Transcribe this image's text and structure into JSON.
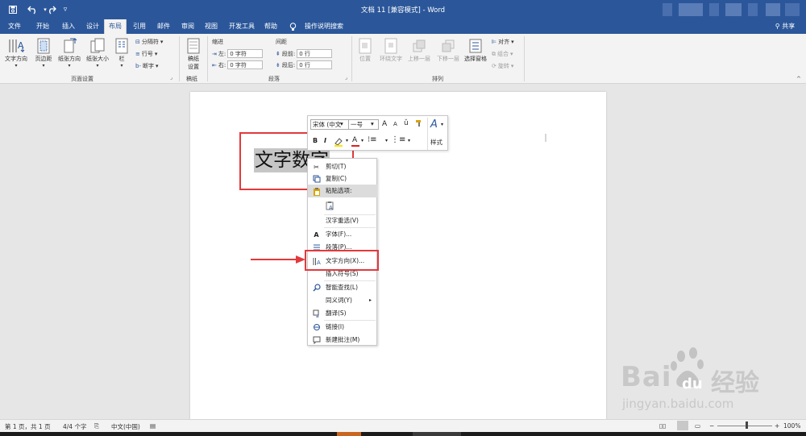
{
  "titlebar": {
    "title": "文档 11 [兼容模式]  -  Word",
    "customize": "▿"
  },
  "tabs": [
    {
      "label": "文件"
    },
    {
      "label": "开始"
    },
    {
      "label": "插入"
    },
    {
      "label": "设计"
    },
    {
      "label": "布局"
    },
    {
      "label": "引用"
    },
    {
      "label": "邮件"
    },
    {
      "label": "审阅"
    },
    {
      "label": "视图"
    },
    {
      "label": "开发工具"
    },
    {
      "label": "帮助"
    },
    {
      "label": "操作说明搜索"
    }
  ],
  "share_label": "共享",
  "ribbon": {
    "page_setup": {
      "text_direction": "文字方向",
      "margins": "页边距",
      "orientation": "纸张方向",
      "size": "纸张大小",
      "columns": "栏",
      "breaks": "分隔符",
      "line_numbers": "行号",
      "hyphenation": "断字",
      "group_label": "页面设置"
    },
    "manuscript": {
      "button": "稿纸\n设置",
      "line1": "稿纸",
      "line2": "设置",
      "group_label": "稿纸"
    },
    "paragraph": {
      "indent_title": "缩进",
      "spacing_title": "间距",
      "left_label": "左:",
      "left_value": "0 字符",
      "right_label": "右:",
      "right_value": "0 字符",
      "before_label": "段前:",
      "before_value": "0 行",
      "after_label": "段后:",
      "after_value": "0 行",
      "group_label": "段落"
    },
    "arrange": {
      "position": "位置",
      "wrap_text": "环绕文字",
      "bring_forward": "上移一层",
      "send_backward": "下移一层",
      "selection_pane": "选择窗格",
      "align": "对齐",
      "group": "组合",
      "rotate": "旋转",
      "group_label": "排列"
    }
  },
  "document": {
    "selected_text": "文字数字"
  },
  "mini_toolbar": {
    "font_name": "宋体 (中文",
    "font_size": "一号",
    "grow": "A",
    "shrink": "A",
    "bold": "B",
    "italic": "I",
    "font_color": "A",
    "styles_label": "样式"
  },
  "context_menu": [
    {
      "label": "剪切(T)",
      "icon": "scissors-icon"
    },
    {
      "label": "复制(C)",
      "icon": "copy-icon"
    },
    {
      "label": "粘贴选项:",
      "icon": "paste-icon"
    },
    {
      "label": "",
      "icon": "paste-text-only-icon"
    },
    {
      "label": "汉字重选(V)",
      "icon": ""
    },
    {
      "label": "字体(F)...",
      "icon": "font-icon"
    },
    {
      "label": "段落(P)...",
      "icon": "paragraph-icon"
    },
    {
      "label": "文字方向(X)...",
      "icon": "text-direction-icon"
    },
    {
      "label": "插入符号(S)",
      "icon": ""
    },
    {
      "label": "智能查找(L)",
      "icon": "smart-lookup-icon"
    },
    {
      "label": "同义词(Y)",
      "icon": ""
    },
    {
      "label": "翻译(S)",
      "icon": "translate-icon"
    },
    {
      "label": "链接(I)",
      "icon": "link-icon"
    },
    {
      "label": "新建批注(M)",
      "icon": "new-comment-icon"
    }
  ],
  "status": {
    "page": "第 1 页，共 1 页",
    "words": "4/4 个字",
    "language": "中文(中国)",
    "zoom": "100%"
  },
  "watermark": {
    "brand": "Bai",
    "brand2": "du",
    "product": "经验",
    "url": "jingyan.baidu.com"
  },
  "colors": {
    "accent": "#2b579a",
    "highlight_box": "#e4393c",
    "font_color_bar": "#e02020"
  }
}
